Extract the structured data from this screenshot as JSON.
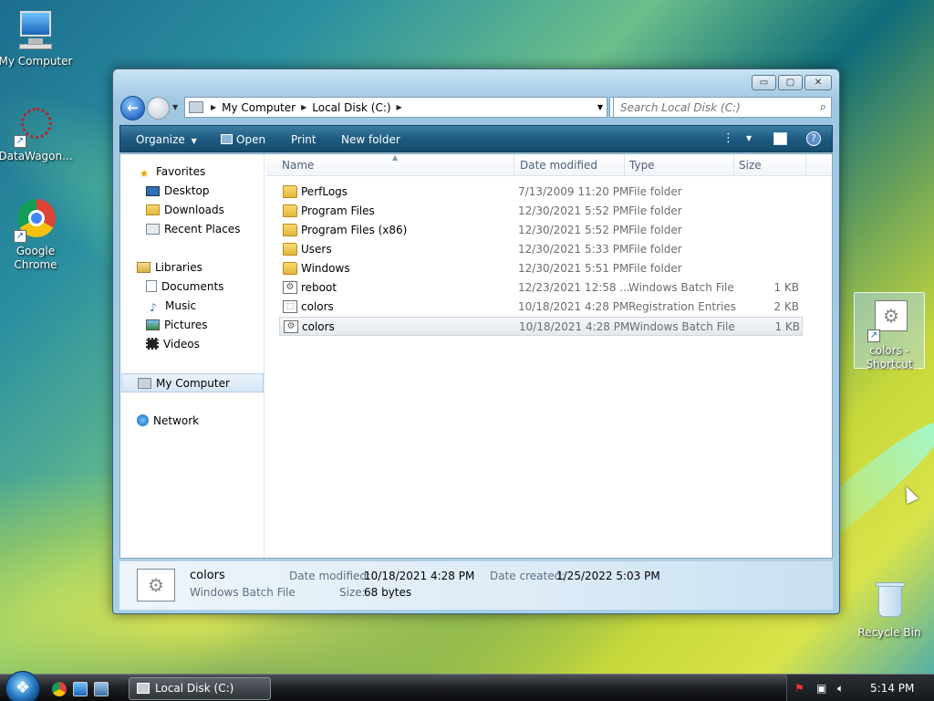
{
  "desktop": {
    "icons": [
      {
        "label": "My Computer",
        "icon": "my-computer-icon"
      },
      {
        "label": "DataWagon...",
        "icon": "datawagon-icon"
      },
      {
        "label": "Google Chrome",
        "icon": "chrome-icon"
      },
      {
        "label": "colors - Shortcut",
        "icon": "batch-shortcut-icon"
      },
      {
        "label": "Recycle Bin",
        "icon": "recycle-bin-icon"
      }
    ]
  },
  "window": {
    "controls": {
      "minimize": "▭",
      "maximize": "▢",
      "close": "✕"
    },
    "address": {
      "segments": [
        "My Computer",
        "Local Disk (C:)"
      ]
    },
    "search": {
      "placeholder": "Search Local Disk (C:)"
    },
    "toolbar": {
      "organize": "Organize",
      "open": "Open",
      "print": "Print",
      "new_folder": "New folder"
    },
    "nav": {
      "favorites_header": "Favorites",
      "favorites": [
        "Desktop",
        "Downloads",
        "Recent Places"
      ],
      "libraries_header": "Libraries",
      "libraries": [
        "Documents",
        "Music",
        "Pictures",
        "Videos"
      ],
      "my_computer": "My Computer",
      "network": "Network"
    },
    "columns": {
      "name": "Name",
      "date": "Date modified",
      "type": "Type",
      "size": "Size"
    },
    "files": [
      {
        "name": "PerfLogs",
        "date": "7/13/2009 11:20 PM",
        "type": "File folder",
        "size": "",
        "icon": "folder"
      },
      {
        "name": "Program Files",
        "date": "12/30/2021 5:52 PM",
        "type": "File folder",
        "size": "",
        "icon": "folder"
      },
      {
        "name": "Program Files (x86)",
        "date": "12/30/2021 5:52 PM",
        "type": "File folder",
        "size": "",
        "icon": "folder"
      },
      {
        "name": "Users",
        "date": "12/30/2021 5:33 PM",
        "type": "File folder",
        "size": "",
        "icon": "folder"
      },
      {
        "name": "Windows",
        "date": "12/30/2021 5:51 PM",
        "type": "File folder",
        "size": "",
        "icon": "folder"
      },
      {
        "name": "reboot",
        "date": "12/23/2021 12:58 ...",
        "type": "Windows Batch File",
        "size": "1 KB",
        "icon": "bat"
      },
      {
        "name": "colors",
        "date": "10/18/2021 4:28 PM",
        "type": "Registration Entries",
        "size": "2 KB",
        "icon": "reg"
      },
      {
        "name": "colors",
        "date": "10/18/2021 4:28 PM",
        "type": "Windows Batch File",
        "size": "1 KB",
        "icon": "bat",
        "selected": true
      }
    ],
    "details": {
      "name": "colors",
      "type": "Windows Batch File",
      "modified_label": "Date modified:",
      "modified_value": "10/18/2021 4:28 PM",
      "created_label": "Date created:",
      "created_value": "1/25/2022 5:03 PM",
      "size_label": "Size:",
      "size_value": "68 bytes"
    }
  },
  "taskbar": {
    "task": "Local Disk (C:)",
    "clock": "5:14 PM"
  }
}
